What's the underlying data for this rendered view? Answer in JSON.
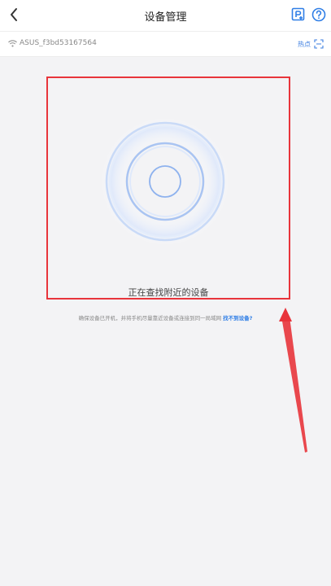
{
  "header": {
    "title": "设备管理",
    "back_icon": "chevron-left-icon",
    "add_device_icon": "add-device-icon",
    "help_icon": "question-circle-icon",
    "accent": "#2f7ee6"
  },
  "network": {
    "wifi_name": "ASUS_f3bd53167564",
    "hotspot_label": "热点",
    "scan_icon": "scan-icon"
  },
  "search": {
    "status_text": "正在查找附近的设备",
    "hint_text": "确保设备已开机，并将手机尽量靠近设备或连接到同一局域网 ",
    "cant_find_link": "找不到设备?"
  },
  "annotation": {
    "box_color": "#e8343b"
  }
}
